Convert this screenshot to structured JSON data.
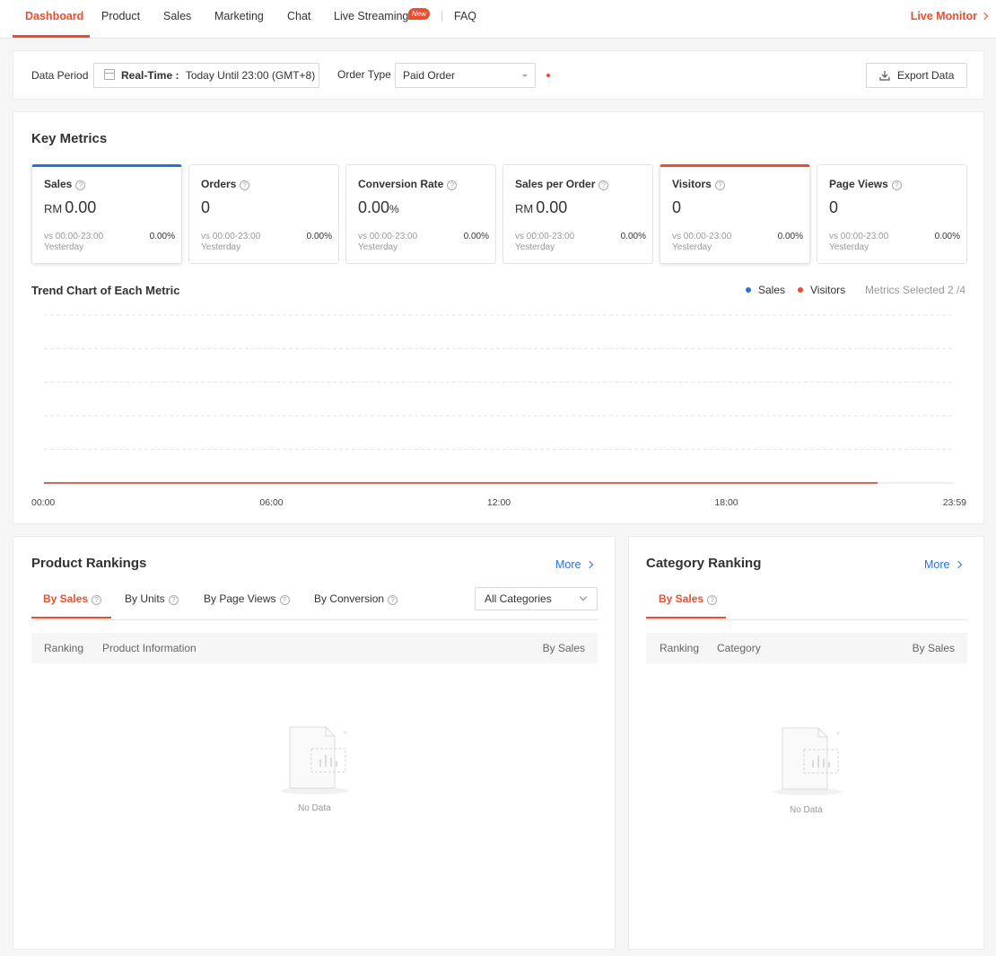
{
  "nav": {
    "tabs": [
      "Dashboard",
      "Product",
      "Sales",
      "Marketing",
      "Chat",
      "Live Streaming",
      "FAQ"
    ],
    "new_badge": "New",
    "live_monitor": "Live Monitor"
  },
  "filters": {
    "data_period_label": "Data Period",
    "period_mode": "Real-Time :",
    "period_value": "Today Until 23:00 (GMT+8)",
    "order_type_label": "Order Type",
    "order_type_value": "Paid Order",
    "export_label": "Export Data"
  },
  "key_metrics": {
    "title": "Key Metrics",
    "metrics": [
      {
        "name": "Sales",
        "currency": "RM",
        "value": "0.00",
        "vs": "vs 00:00-23:00",
        "vs2": "Yesterday",
        "change": "0.00%"
      },
      {
        "name": "Orders",
        "currency": "",
        "value": "0",
        "vs": "vs 00:00-23:00",
        "vs2": "Yesterday",
        "change": "0.00%"
      },
      {
        "name": "Conversion Rate",
        "currency": "",
        "value": "0.00",
        "unit": "%",
        "vs": "vs 00:00-23:00",
        "vs2": "Yesterday",
        "change": "0.00%"
      },
      {
        "name": "Sales per Order",
        "currency": "RM",
        "value": "0.00",
        "vs": "vs 00:00-23:00",
        "vs2": "Yesterday",
        "change": "0.00%"
      },
      {
        "name": "Visitors",
        "currency": "",
        "value": "0",
        "vs": "vs 00:00-23:00",
        "vs2": "Yesterday",
        "change": "0.00%"
      },
      {
        "name": "Page Views",
        "currency": "",
        "value": "0",
        "vs": "vs 00:00-23:00",
        "vs2": "Yesterday",
        "change": "0.00%"
      }
    ]
  },
  "trend": {
    "title": "Trend Chart of Each Metric",
    "legend": [
      "Sales",
      "Visitors"
    ],
    "metrics_selected": "Metrics Selected 2 /4",
    "colors": {
      "sales": "#2673dd",
      "visitors": "#ee4d2d"
    }
  },
  "chart_data": {
    "type": "line",
    "x_ticks": [
      "00:00",
      "06:00",
      "12:00",
      "18:00",
      "23:59"
    ],
    "series": [
      {
        "name": "Sales",
        "values": [
          0,
          0,
          0,
          0,
          0
        ]
      },
      {
        "name": "Visitors",
        "values": [
          0,
          0,
          0,
          0,
          0
        ]
      }
    ],
    "grid": true,
    "legend_position": "top-right"
  },
  "product_rankings": {
    "title": "Product Rankings",
    "more": "More",
    "tabs": [
      "By Sales",
      "By Units",
      "By Page Views",
      "By Conversion"
    ],
    "category_select": "All Categories",
    "columns": [
      "Ranking",
      "Product Information",
      "By Sales"
    ],
    "empty": "No Data"
  },
  "category_ranking": {
    "title": "Category Ranking",
    "more": "More",
    "tabs": [
      "By Sales"
    ],
    "columns": [
      "Ranking",
      "Category",
      "By Sales"
    ],
    "empty": "No Data"
  }
}
